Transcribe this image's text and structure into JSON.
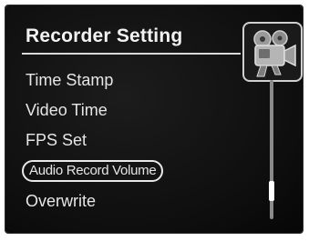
{
  "header": {
    "title": "Recorder Setting",
    "icon": "camcorder-icon"
  },
  "menu": {
    "items": [
      {
        "label": "Time Stamp",
        "selected": false
      },
      {
        "label": "Video Time",
        "selected": false
      },
      {
        "label": "FPS Set",
        "selected": false
      },
      {
        "label": "Audio Record Volume",
        "selected": true
      },
      {
        "label": "Overwrite",
        "selected": false
      }
    ]
  },
  "scrollbar": {
    "position_fraction": 0.85
  },
  "colors": {
    "background": "#111111",
    "text": "#e6e6e6",
    "highlight_outline": "#e8e8e8"
  }
}
